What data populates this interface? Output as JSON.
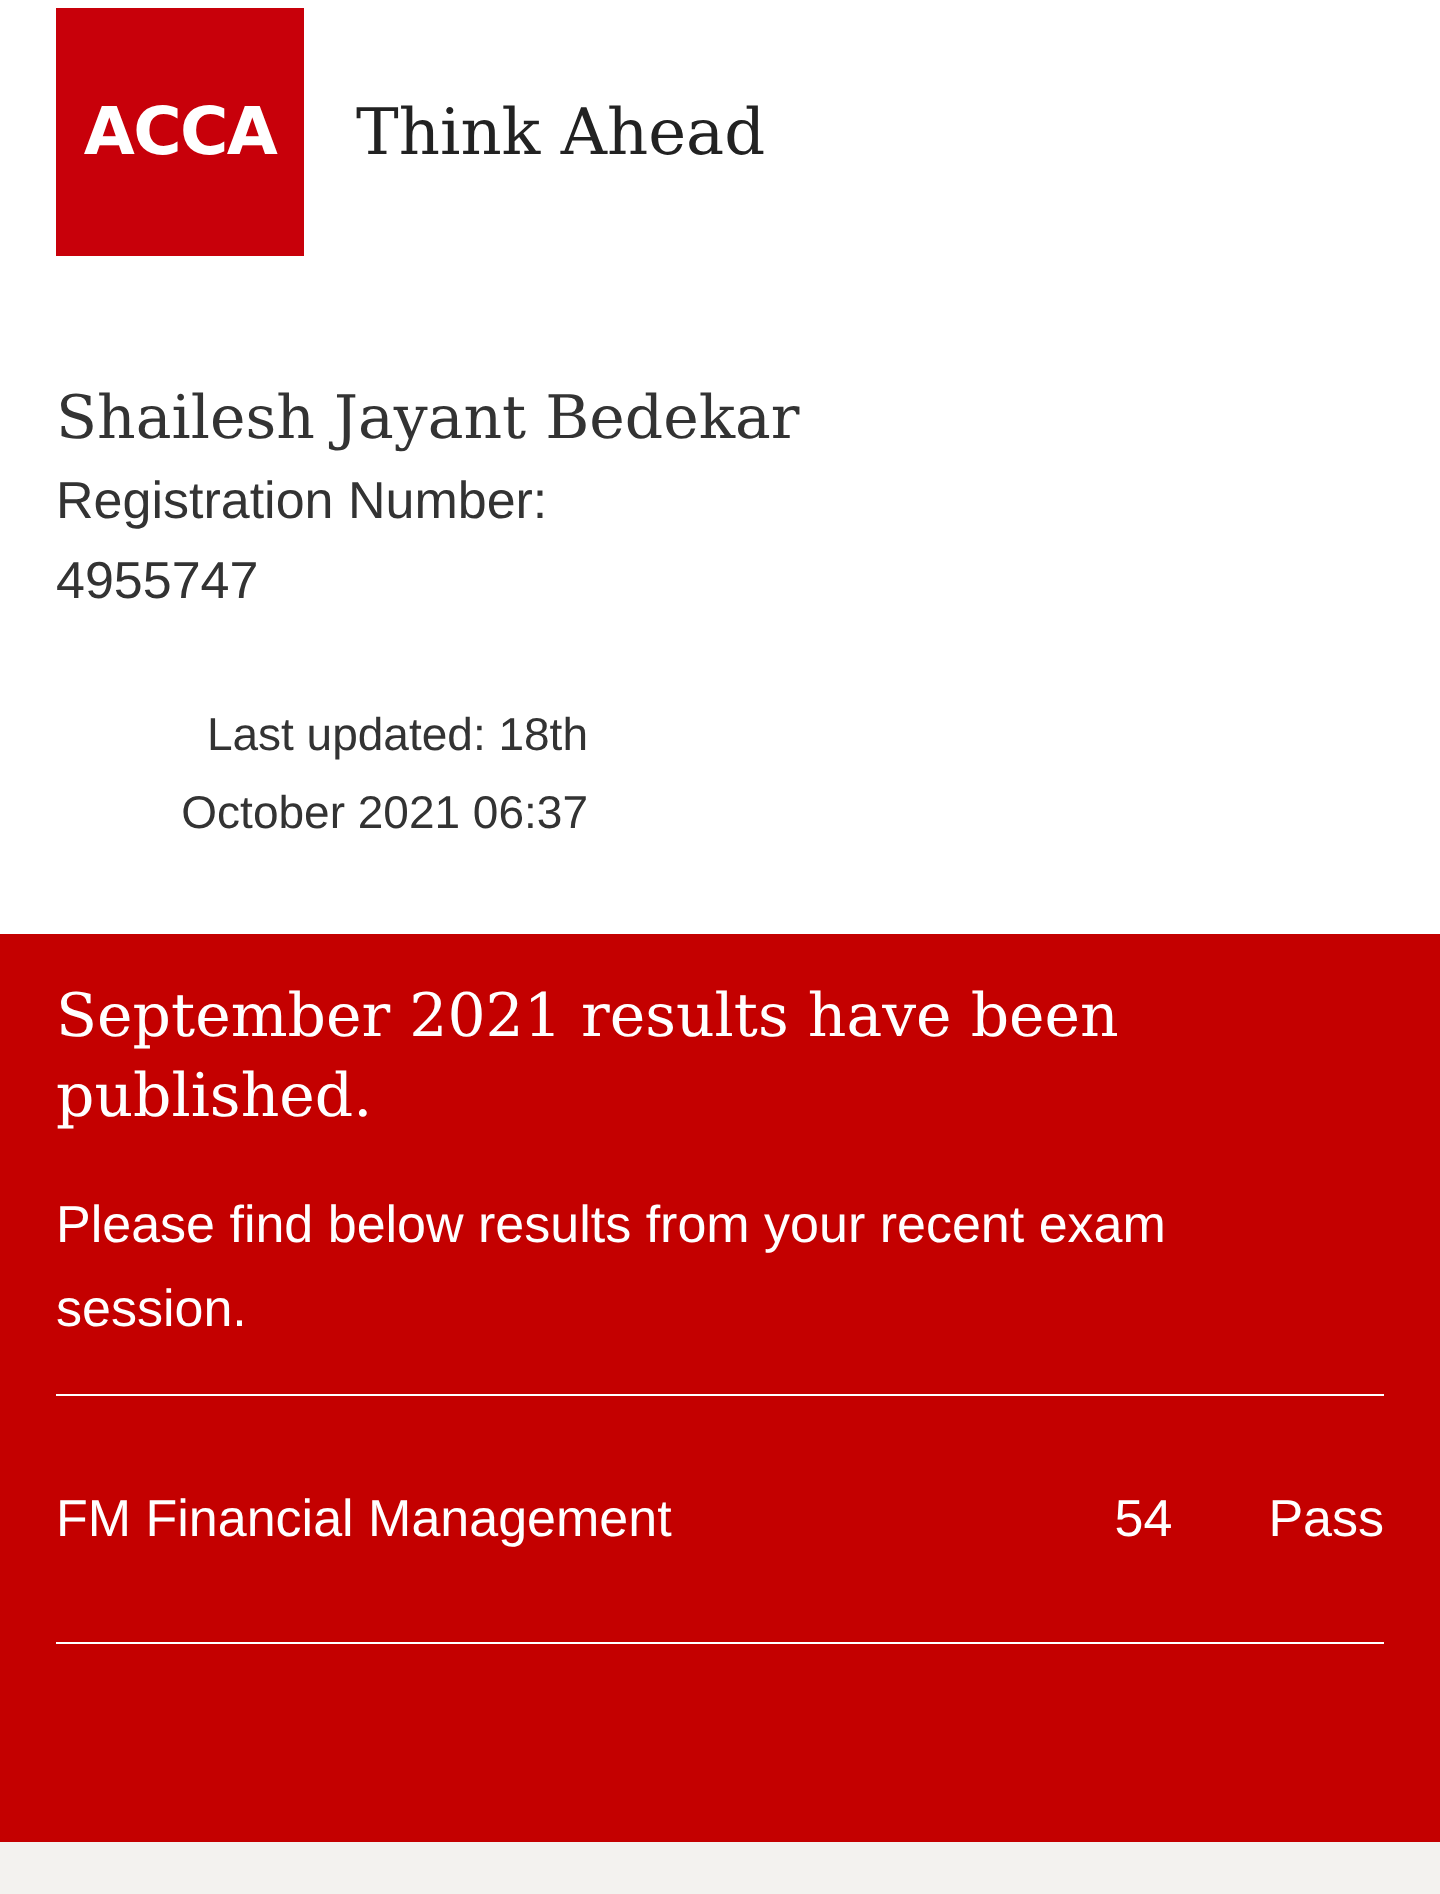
{
  "logo": {
    "text": "ACCA"
  },
  "tagline": "Think Ahead",
  "student": {
    "name": "Shailesh Jayant Bedekar",
    "registration_label": "Registration Number:",
    "registration_number": "4955747"
  },
  "last_updated": [
    "Last updated: 18th",
    "October 2021 06:37"
  ],
  "results_panel": {
    "heading": "September 2021 results have been published.",
    "intro": "Please find below results from your recent exam session.",
    "rows": [
      {
        "exam": "FM Financial Management",
        "mark": "54",
        "result": "Pass"
      }
    ]
  }
}
